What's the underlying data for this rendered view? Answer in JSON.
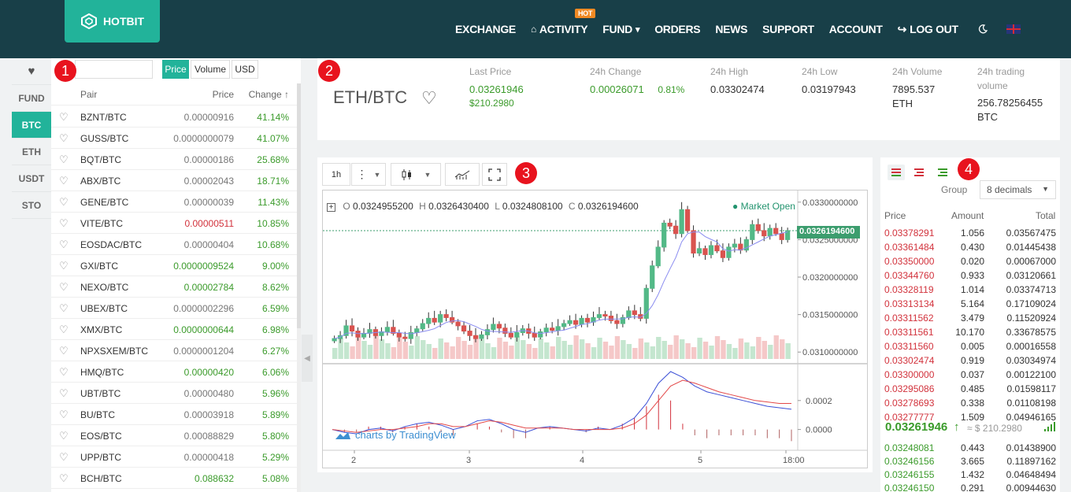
{
  "header": {
    "logo_text": "HOTBIT",
    "nav": [
      {
        "label": "EXCHANGE",
        "prefix": ""
      },
      {
        "label": "ACTIVITY",
        "prefix": "⌂",
        "badge": "HOT"
      },
      {
        "label": "FUND",
        "suffix": "▾"
      },
      {
        "label": "ORDERS"
      },
      {
        "label": "NEWS"
      },
      {
        "label": "SUPPORT"
      },
      {
        "label": "ACCOUNT"
      },
      {
        "label": "LOG OUT",
        "prefix": "↪"
      }
    ],
    "theme_icon": "moon-icon",
    "language_icon": "uk-flag-icon"
  },
  "sidebar": {
    "tabs": [
      "♥",
      "FUND",
      "BTC",
      "ETH",
      "USDT",
      "STO"
    ],
    "active_tab": "BTC"
  },
  "market_list": {
    "search_placeholder": "",
    "toggles": [
      "Price",
      "Volume",
      "USD"
    ],
    "active_toggle": "Price",
    "columns": {
      "pair": "Pair",
      "price": "Price",
      "change": "Change ↑"
    },
    "rows": [
      {
        "pair": "BZNT/BTC",
        "price": "0.00000916",
        "price_color": "gray",
        "change": "41.14%"
      },
      {
        "pair": "GUSS/BTC",
        "price": "0.0000000079",
        "price_color": "gray",
        "change": "41.07%"
      },
      {
        "pair": "BQT/BTC",
        "price": "0.00000186",
        "price_color": "gray",
        "change": "25.68%"
      },
      {
        "pair": "ABX/BTC",
        "price": "0.00002043",
        "price_color": "gray",
        "change": "18.71%"
      },
      {
        "pair": "GENE/BTC",
        "price": "0.00000039",
        "price_color": "gray",
        "change": "11.43%"
      },
      {
        "pair": "VITE/BTC",
        "price": "0.00000511",
        "price_color": "red",
        "change": "10.85%"
      },
      {
        "pair": "EOSDAC/BTC",
        "price": "0.00000404",
        "price_color": "gray",
        "change": "10.68%"
      },
      {
        "pair": "GXI/BTC",
        "price": "0.0000009524",
        "price_color": "green",
        "change": "9.00%"
      },
      {
        "pair": "NEXO/BTC",
        "price": "0.00002784",
        "price_color": "green",
        "change": "8.62%"
      },
      {
        "pair": "UBEX/BTC",
        "price": "0.0000002296",
        "price_color": "gray",
        "change": "6.59%"
      },
      {
        "pair": "XMX/BTC",
        "price": "0.0000000644",
        "price_color": "green",
        "change": "6.98%"
      },
      {
        "pair": "NPXSXEM/BTC",
        "price": "0.0000001204",
        "price_color": "gray",
        "change": "6.27%"
      },
      {
        "pair": "HMQ/BTC",
        "price": "0.00000420",
        "price_color": "green",
        "change": "6.06%"
      },
      {
        "pair": "UBT/BTC",
        "price": "0.00000480",
        "price_color": "gray",
        "change": "5.96%"
      },
      {
        "pair": "BU/BTC",
        "price": "0.00003918",
        "price_color": "gray",
        "change": "5.89%"
      },
      {
        "pair": "EOS/BTC",
        "price": "0.00088829",
        "price_color": "gray",
        "change": "5.80%"
      },
      {
        "pair": "UPP/BTC",
        "price": "0.00000418",
        "price_color": "gray",
        "change": "5.29%"
      },
      {
        "pair": "BCH/BTC",
        "price": "0.088632",
        "price_color": "green",
        "change": "5.08%"
      }
    ]
  },
  "ticker": {
    "pair": "ETH/BTC",
    "last_price_label": "Last Price",
    "last_price": "0.03261946",
    "last_price_usd": "$210.2980",
    "change_label": "24h Change",
    "change_value": "0.00026071",
    "change_pct": "0.81%",
    "high_label": "24h High",
    "high": "0.03302474",
    "low_label": "24h Low",
    "low": "0.03197943",
    "volume_label": "24h Volume",
    "volume": "7895.537",
    "volume_unit": "ETH",
    "trading_volume_label_1": "24h trading",
    "trading_volume_label_2": "volume",
    "trading_volume": "256.78256455",
    "trading_volume_unit": "BTC"
  },
  "chart_toolbar": {
    "interval": "1h"
  },
  "chart": {
    "ohlc_o_label": "O",
    "ohlc_o": "0.0324955200",
    "ohlc_h_label": "H",
    "ohlc_h": "0.0326430400",
    "ohlc_l_label": "L",
    "ohlc_l": "0.0324808100",
    "ohlc_c_label": "C",
    "ohlc_c": "0.0326194600",
    "market_status": "Market Open",
    "current_price_tag": "0.0326194600",
    "watermark": "charts by TradingView",
    "colors": {
      "up": "#53b987",
      "down": "#d9534f",
      "ma1": "#8a8cf0",
      "ma2": "#6fb7a8"
    }
  },
  "chart_data": [
    {
      "type": "candlestick",
      "title": "",
      "y_ticks": [
        "0.0330000000",
        "0.0325000000",
        "0.0320000000",
        "0.0315000000",
        "0.0310000000"
      ],
      "ylim": [
        0.03095,
        0.03305
      ],
      "x_ticks": [
        "2",
        "3",
        "4",
        "5",
        "18:00"
      ],
      "last": {
        "open": 0.03249552,
        "high": 0.03264304,
        "low": 0.03248081,
        "close": 0.03261946
      },
      "close_series": [
        0.03118,
        0.03122,
        0.03135,
        0.03128,
        0.0312,
        0.03125,
        0.0313,
        0.03122,
        0.03127,
        0.03133,
        0.03125,
        0.0312,
        0.03118,
        0.03126,
        0.03131,
        0.03138,
        0.03145,
        0.0314,
        0.0315,
        0.03146,
        0.0314,
        0.03135,
        0.03128,
        0.03122,
        0.03118,
        0.03123,
        0.0313,
        0.03137,
        0.03132,
        0.03125,
        0.0312,
        0.03126,
        0.03131,
        0.03125,
        0.0312,
        0.03127,
        0.03132,
        0.03129,
        0.03134,
        0.03138,
        0.03142,
        0.03137,
        0.03145,
        0.0314,
        0.03146,
        0.0315,
        0.03148,
        0.03142,
        0.03138,
        0.03146,
        0.03155,
        0.0315,
        0.03145,
        0.03185,
        0.03215,
        0.0324,
        0.03272,
        0.03268,
        0.03258,
        0.0329,
        0.03262,
        0.03232,
        0.03238,
        0.0323,
        0.03242,
        0.03235,
        0.03226,
        0.0324,
        0.03244,
        0.03236,
        0.0325,
        0.0327,
        0.03262,
        0.03255,
        0.03265,
        0.03258,
        0.0325,
        0.03262
      ]
    },
    {
      "type": "line",
      "title": "",
      "y_ticks": [
        "0.0002",
        "0.0000"
      ],
      "ylim": [
        -0.0001,
        0.0004
      ],
      "series": [
        {
          "name": "",
          "color": "#3b4fd6",
          "values": [
            0.0,
            -2e-05,
            -3e-05,
            0.0,
            1e-05,
            -1e-05,
            2e-05,
            4e-05,
            5e-05,
            3e-05,
            0.0,
            2e-05,
            6e-05,
            7e-05,
            4e-05,
            0.0,
            -2e-05,
            1e-05,
            2e-05,
            1e-05,
            0.0,
            -1e-05,
            1e-05,
            0.0,
            3e-05,
            8e-05,
            0.00018,
            0.00032,
            0.0004,
            0.00036,
            0.0003,
            0.00026,
            0.00024,
            0.00022,
            0.0002,
            0.00018,
            0.00016,
            0.00015,
            0.00014
          ]
        },
        {
          "name": "",
          "color": "#e34848",
          "values": [
            0.0,
            -1e-05,
            -2e-05,
            -1e-05,
            0.0,
            0.0,
            1e-05,
            2e-05,
            4e-05,
            4e-05,
            2e-05,
            2e-05,
            4e-05,
            6e-05,
            5e-05,
            3e-05,
            1e-05,
            1e-05,
            1e-05,
            1e-05,
            0.0,
            0.0,
            0.0,
            0.0,
            1e-05,
            4e-05,
            0.0001,
            0.0002,
            0.0003,
            0.00034,
            0.00032,
            0.00029,
            0.00026,
            0.00024,
            0.00022,
            0.0002,
            0.00019,
            0.00018,
            0.00018
          ]
        }
      ]
    }
  ],
  "orderbook": {
    "group_label": "Group",
    "decimals": "8 decimals",
    "columns": {
      "price": "Price",
      "amount": "Amount",
      "total": "Total"
    },
    "asks": [
      {
        "price": "0.03378291",
        "amount": "1.056",
        "total": "0.03567475"
      },
      {
        "price": "0.03361484",
        "amount": "0.430",
        "total": "0.01445438"
      },
      {
        "price": "0.03350000",
        "amount": "0.020",
        "total": "0.00067000"
      },
      {
        "price": "0.03344760",
        "amount": "0.933",
        "total": "0.03120661"
      },
      {
        "price": "0.03328119",
        "amount": "1.014",
        "total": "0.03374713"
      },
      {
        "price": "0.03313134",
        "amount": "5.164",
        "total": "0.17109024"
      },
      {
        "price": "0.03311562",
        "amount": "3.479",
        "total": "0.11520924"
      },
      {
        "price": "0.03311561",
        "amount": "10.170",
        "total": "0.33678575"
      },
      {
        "price": "0.03311560",
        "amount": "0.005",
        "total": "0.00016558"
      },
      {
        "price": "0.03302474",
        "amount": "0.919",
        "total": "0.03034974"
      },
      {
        "price": "0.03300000",
        "amount": "0.037",
        "total": "0.00122100"
      },
      {
        "price": "0.03295086",
        "amount": "0.485",
        "total": "0.01598117"
      },
      {
        "price": "0.03278693",
        "amount": "0.338",
        "total": "0.01108198"
      },
      {
        "price": "0.03277777",
        "amount": "1.509",
        "total": "0.04946165"
      }
    ],
    "last_price": "0.03261946",
    "last_arrow": "↑",
    "last_usd": "≈ $ 210.2980",
    "bids": [
      {
        "price": "0.03248081",
        "amount": "0.443",
        "total": "0.01438900"
      },
      {
        "price": "0.03246156",
        "amount": "3.665",
        "total": "0.11897162"
      },
      {
        "price": "0.03246155",
        "amount": "1.432",
        "total": "0.04648494"
      },
      {
        "price": "0.03246150",
        "amount": "0.291",
        "total": "0.00944630"
      }
    ]
  },
  "annotations": [
    "1",
    "2",
    "3",
    "4"
  ]
}
